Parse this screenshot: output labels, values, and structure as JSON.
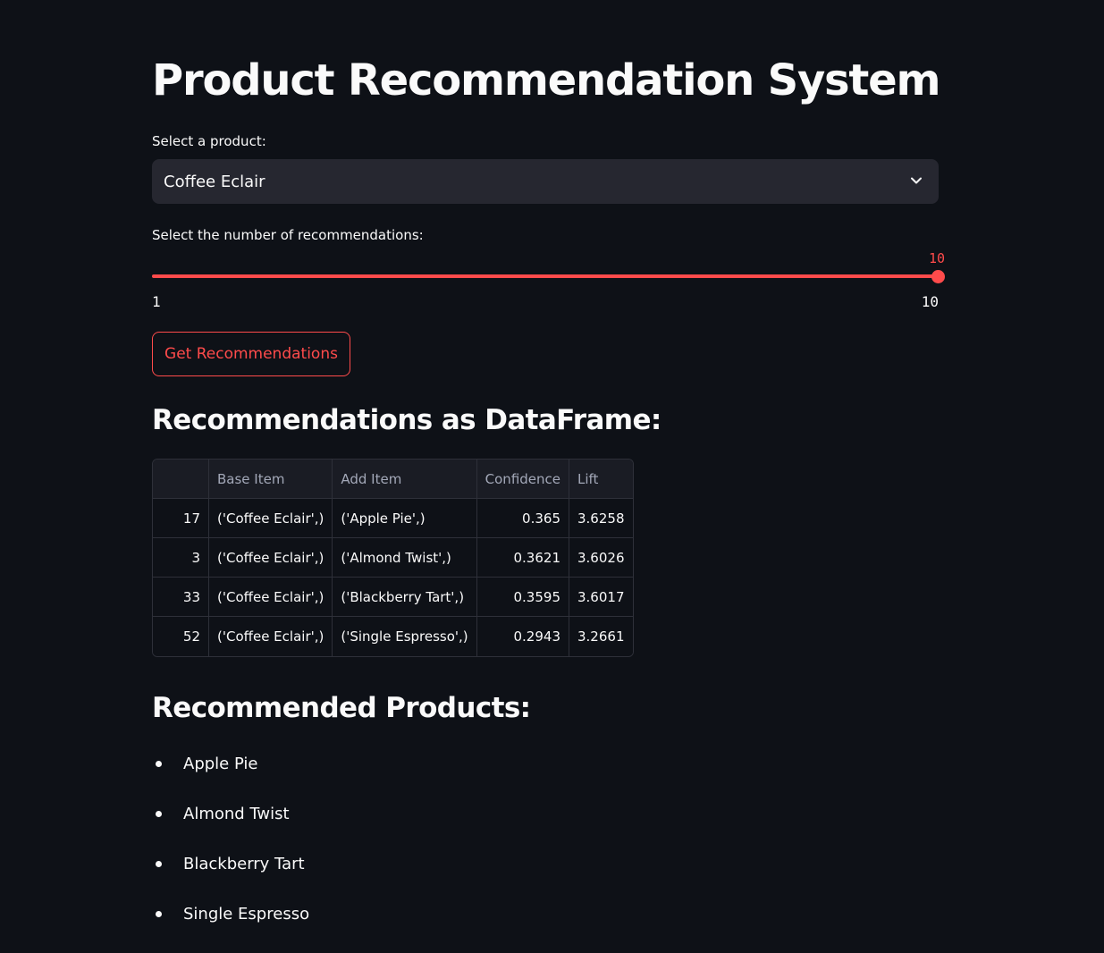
{
  "page": {
    "title": "Product Recommendation System"
  },
  "product_select": {
    "label": "Select a product:",
    "value": "Coffee Eclair"
  },
  "count_slider": {
    "label": "Select the number of recommendations:",
    "value": "10",
    "min": "1",
    "max": "10",
    "fraction": 1.0
  },
  "button": {
    "label": "Get Recommendations"
  },
  "dataframe": {
    "heading": "Recommendations as DataFrame:",
    "columns": [
      "",
      "Base Item",
      "Add Item",
      "Confidence",
      "Lift"
    ],
    "rows": [
      {
        "index": "17",
        "base": "('Coffee Eclair',)",
        "add": "('Apple Pie',)",
        "confidence": "0.365",
        "lift": "3.6258"
      },
      {
        "index": "3",
        "base": "('Coffee Eclair',)",
        "add": "('Almond Twist',)",
        "confidence": "0.3621",
        "lift": "3.6026"
      },
      {
        "index": "33",
        "base": "('Coffee Eclair',)",
        "add": "('Blackberry Tart',)",
        "confidence": "0.3595",
        "lift": "3.6017"
      },
      {
        "index": "52",
        "base": "('Coffee Eclair',)",
        "add": "('Single Espresso',)",
        "confidence": "0.2943",
        "lift": "3.2661"
      }
    ]
  },
  "recommended": {
    "heading": "Recommended Products:",
    "items": [
      "Apple Pie",
      "Almond Twist",
      "Blackberry Tart",
      "Single Espresso"
    ]
  },
  "colors": {
    "accent": "#ff4b4b",
    "background": "#0e1117",
    "input_bg": "#262730"
  }
}
